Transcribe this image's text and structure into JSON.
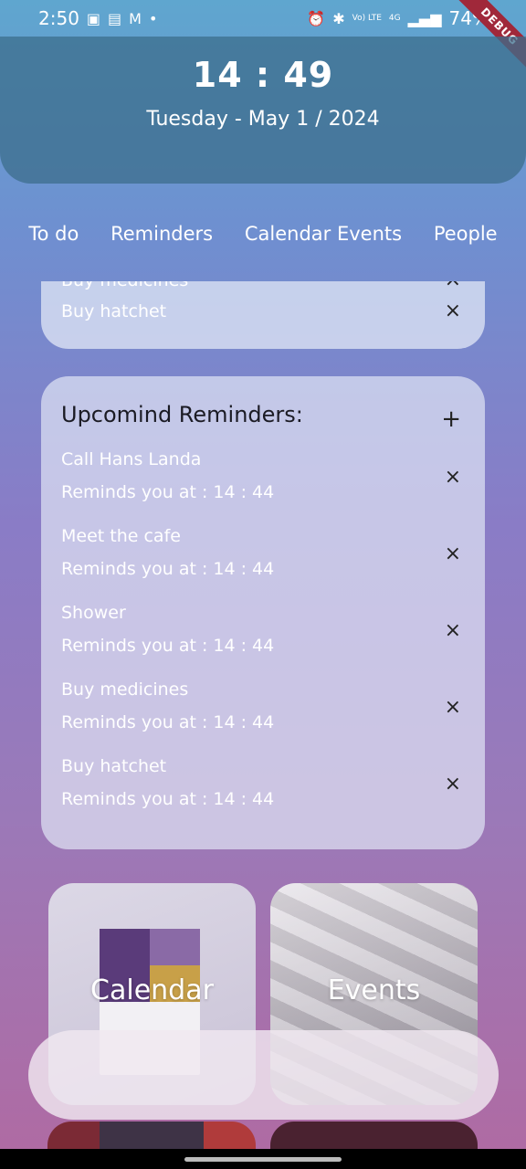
{
  "status_bar": {
    "time": "2:50",
    "icons_left": [
      "image-icon",
      "linkedin-icon",
      "gmail-icon",
      "dot-icon"
    ],
    "icons_right": [
      "alarm-icon",
      "bluetooth-icon",
      "volte-icon",
      "4g-icon",
      "signal-icon",
      "battery-icon"
    ],
    "volte_label": "Vo) LTE",
    "network_label": "4G",
    "battery": "74%"
  },
  "debug_banner": "DEBUG",
  "header": {
    "clock": "14 : 49",
    "date": "Tuesday - May 1 / 2024"
  },
  "tabs": [
    {
      "label": "To do"
    },
    {
      "label": "Reminders"
    },
    {
      "label": "Calendar Events"
    },
    {
      "label": "People"
    }
  ],
  "todo": {
    "items": [
      {
        "label": "Buy medicines"
      },
      {
        "label": "Buy hatchet"
      }
    ],
    "remove_icon": "×"
  },
  "reminders": {
    "title": "Upcomind Reminders:",
    "add_icon": "+",
    "remove_icon": "×",
    "items": [
      {
        "name": "Call Hans Landa",
        "time": "Reminds you at : 14 : 44"
      },
      {
        "name": "Meet the cafe",
        "time": "Reminds you at : 14 : 44"
      },
      {
        "name": "Shower",
        "time": "Reminds you at : 14 : 44"
      },
      {
        "name": "Buy medicines",
        "time": "Reminds you at : 14 : 44"
      },
      {
        "name": "Buy hatchet",
        "time": "Reminds you at : 14 : 44"
      }
    ]
  },
  "tiles": [
    {
      "label": "Calendar"
    },
    {
      "label": "Events"
    }
  ]
}
